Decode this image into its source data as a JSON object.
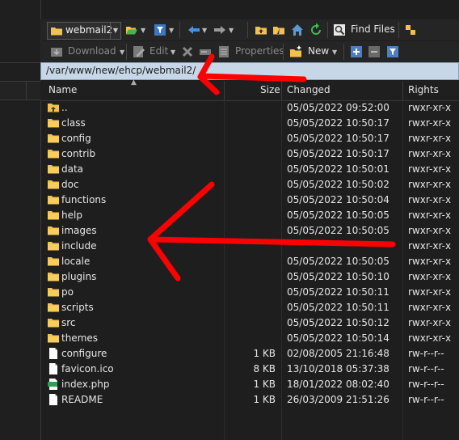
{
  "toolbar": {
    "site_combo": "webmail2",
    "find_files": "Find Files",
    "download": "Download",
    "edit": "Edit",
    "properties": "Properties",
    "new": "New"
  },
  "path": "/var/www/new/ehcp/webmail2/",
  "columns": {
    "name": "Name",
    "size": "Size",
    "changed": "Changed",
    "rights": "Rights"
  },
  "files": [
    {
      "name": "..",
      "size": "",
      "changed": "05/05/2022 09:52:00",
      "rights": "rwxr-xr-x",
      "icon": "folder-up-icon"
    },
    {
      "name": "class",
      "size": "",
      "changed": "05/05/2022 10:50:17",
      "rights": "rwxr-xr-x",
      "icon": "folder-icon"
    },
    {
      "name": "config",
      "size": "",
      "changed": "05/05/2022 10:50:17",
      "rights": "rwxr-xr-x",
      "icon": "folder-icon"
    },
    {
      "name": "contrib",
      "size": "",
      "changed": "05/05/2022 10:50:17",
      "rights": "rwxr-xr-x",
      "icon": "folder-icon"
    },
    {
      "name": "data",
      "size": "",
      "changed": "05/05/2022 10:50:01",
      "rights": "rwxr-xr-x",
      "icon": "folder-icon"
    },
    {
      "name": "doc",
      "size": "",
      "changed": "05/05/2022 10:50:02",
      "rights": "rwxr-xr-x",
      "icon": "folder-icon"
    },
    {
      "name": "functions",
      "size": "",
      "changed": "05/05/2022 10:50:04",
      "rights": "rwxr-xr-x",
      "icon": "folder-icon"
    },
    {
      "name": "help",
      "size": "",
      "changed": "05/05/2022 10:50:05",
      "rights": "rwxr-xr-x",
      "icon": "folder-icon"
    },
    {
      "name": "images",
      "size": "",
      "changed": "05/05/2022 10:50:05",
      "rights": "rwxr-xr-x",
      "icon": "folder-icon"
    },
    {
      "name": "include",
      "size": "",
      "changed": "",
      "rights": "rwxr-xr-x",
      "icon": "folder-icon"
    },
    {
      "name": "locale",
      "size": "",
      "changed": "05/05/2022 10:50:05",
      "rights": "rwxr-xr-x",
      "icon": "folder-icon"
    },
    {
      "name": "plugins",
      "size": "",
      "changed": "05/05/2022 10:50:10",
      "rights": "rwxr-xr-x",
      "icon": "folder-icon"
    },
    {
      "name": "po",
      "size": "",
      "changed": "05/05/2022 10:50:11",
      "rights": "rwxr-xr-x",
      "icon": "folder-icon"
    },
    {
      "name": "scripts",
      "size": "",
      "changed": "05/05/2022 10:50:11",
      "rights": "rwxr-xr-x",
      "icon": "folder-icon"
    },
    {
      "name": "src",
      "size": "",
      "changed": "05/05/2022 10:50:12",
      "rights": "rwxr-xr-x",
      "icon": "folder-icon"
    },
    {
      "name": "themes",
      "size": "",
      "changed": "05/05/2022 10:50:14",
      "rights": "rwxr-xr-x",
      "icon": "folder-icon"
    },
    {
      "name": "configure",
      "size": "1 KB",
      "changed": "02/08/2005 21:16:48",
      "rights": "rw-r--r--",
      "icon": "file-icon"
    },
    {
      "name": "favicon.ico",
      "size": "8 KB",
      "changed": "13/10/2018 05:37:38",
      "rights": "rw-r--r--",
      "icon": "file-icon"
    },
    {
      "name": "index.php",
      "size": "1 KB",
      "changed": "18/01/2022 08:02:40",
      "rights": "rw-r--r--",
      "icon": "php-file-icon"
    },
    {
      "name": "README",
      "size": "1 KB",
      "changed": "26/03/2009 21:51:26",
      "rights": "rw-r--r--",
      "icon": "file-icon"
    }
  ],
  "colors": {
    "background": "#1e1e1e",
    "pathbar": "#c8d7e8",
    "folder": "#f2c14e",
    "annotation": "#ff0000"
  }
}
